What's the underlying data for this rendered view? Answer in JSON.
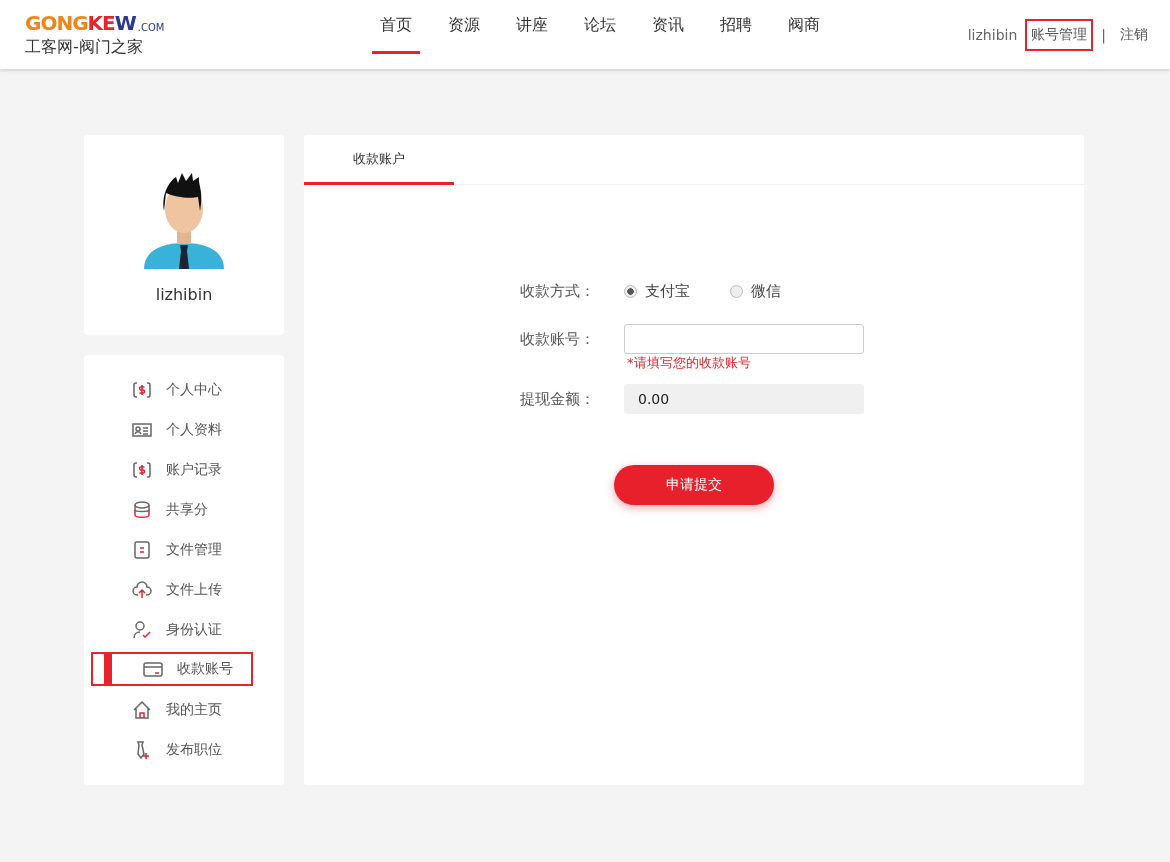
{
  "logo": {
    "parts": [
      {
        "text": "GONG",
        "color": "#f08519"
      },
      {
        "text": "KE",
        "color": "#e5242b"
      },
      {
        "text": "W",
        "color": "#2b3990"
      }
    ],
    "suffix": ".COM",
    "tagline": "工客网-阀门之家"
  },
  "nav": [
    {
      "label": "首页",
      "selected": true
    },
    {
      "label": "资源",
      "selected": false
    },
    {
      "label": "讲座",
      "selected": false
    },
    {
      "label": "论坛",
      "selected": false
    },
    {
      "label": "资讯",
      "selected": false
    },
    {
      "label": "招聘",
      "selected": false
    },
    {
      "label": "阀商",
      "selected": false
    }
  ],
  "account": {
    "user": "lizhibin",
    "manage": {
      "label": "账号管理",
      "selected": true
    },
    "separator": "|",
    "logout": "注销"
  },
  "profile": {
    "name": "lizhibin"
  },
  "sidebar": {
    "items": [
      {
        "label": "个人中心",
        "selected": false
      },
      {
        "label": "个人资料",
        "selected": false
      },
      {
        "label": "账户记录",
        "selected": false
      },
      {
        "label": "共享分",
        "selected": false
      },
      {
        "label": "文件管理",
        "selected": false
      },
      {
        "label": "文件上传",
        "selected": false
      },
      {
        "label": "身份认证",
        "selected": false
      },
      {
        "label": "收款账号",
        "selected": true
      },
      {
        "label": "我的主页",
        "selected": false
      },
      {
        "label": "发布职位",
        "selected": false
      }
    ]
  },
  "tabs": [
    {
      "label": "收款账户",
      "selected": true
    }
  ],
  "form": {
    "method": {
      "label": "收款方式：",
      "options": [
        {
          "label": "支付宝",
          "selected": true
        },
        {
          "label": "微信",
          "selected": false
        }
      ]
    },
    "account": {
      "label": "收款账号：",
      "hint": "*请填写您的收款账号"
    },
    "amount": {
      "label": "提现金额：",
      "value": "0.00"
    },
    "submit": "申请提交"
  }
}
